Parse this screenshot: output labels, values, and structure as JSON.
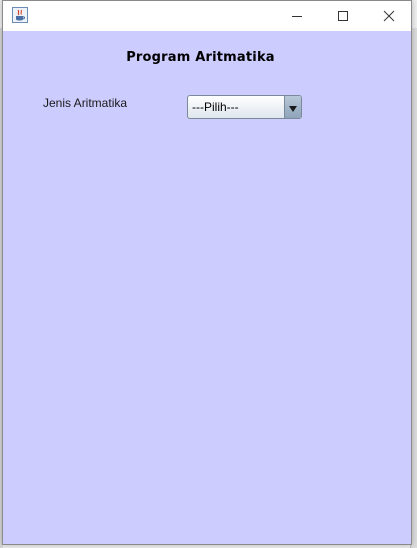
{
  "window": {
    "title": ""
  },
  "titlebar": {
    "app_icon": "java-app-icon",
    "buttons": [
      "minimize-icon",
      "maximize-icon",
      "close-icon"
    ]
  },
  "content": {
    "heading": "Program Aritmatika",
    "label_jenis": "Jenis Aritmatika",
    "combo": {
      "selected": "---Pilih---"
    }
  },
  "colors": {
    "panel_background": "#ccccff",
    "titlebar_background": "#ffffff"
  }
}
